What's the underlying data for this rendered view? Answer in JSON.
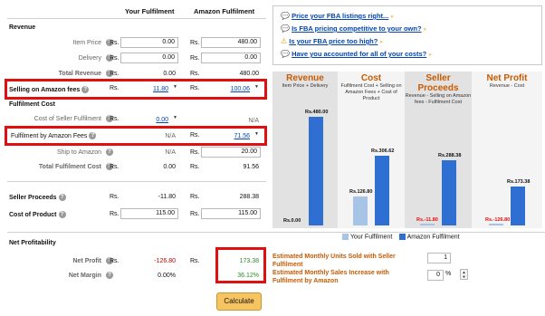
{
  "columns": {
    "your": "Your Fulfilment",
    "amazon": "Amazon Fulfilment"
  },
  "currency": "Rs.",
  "revenue": {
    "heading": "Revenue",
    "item_price": {
      "label": "Item Price",
      "your": "0.00",
      "amazon": "480.00"
    },
    "delivery": {
      "label": "Delivery",
      "your": "0.00",
      "amazon": "0.00"
    },
    "total": {
      "label": "Total Revenue",
      "your": "0.00",
      "amazon": "480.00"
    }
  },
  "selling_fees": {
    "label": "Selling on Amazon fees",
    "your": "11.80",
    "amazon": "100.06"
  },
  "fulfilment": {
    "heading": "Fulfilment Cost",
    "cost_seller": {
      "label": "Cost of Seller Fulfilment",
      "your": "0.00",
      "amazon": "N/A"
    },
    "by_amazon": {
      "label": "Fulfilment by Amazon Fees",
      "your": "N/A",
      "amazon": "71.56"
    },
    "ship": {
      "label": "Ship to Amazon",
      "your": "N/A",
      "amazon": "20.00"
    },
    "total": {
      "label": "Total Fulfilment Cost",
      "your": "0.00",
      "amazon": "91.56"
    }
  },
  "seller_proceeds": {
    "label": "Seller Proceeds",
    "your": "-11.80",
    "amazon": "288.38"
  },
  "cost_of_product": {
    "label": "Cost of Product",
    "your": "115.00",
    "amazon": "115.00"
  },
  "net": {
    "heading": "Net Profitability",
    "profit": {
      "label": "Net Profit",
      "your": "-126.80",
      "amazon": "173.38"
    },
    "margin": {
      "label": "Net Margin",
      "your": "0.00%",
      "amazon": "36.12%"
    }
  },
  "calculate_label": "Calculate",
  "links": [
    {
      "text": "Price your FBA listings right...",
      "icon": "speech-bubble-icon"
    },
    {
      "text": "Is FBA pricing competitive to your own?",
      "icon": "speech-bubble-icon"
    },
    {
      "text": "Is your FBA price too high?",
      "icon": "warning-icon"
    },
    {
      "text": "Have you accounted for all of your costs?",
      "icon": "speech-bubble-icon"
    }
  ],
  "chart": {
    "columns": [
      {
        "title": "Revenue",
        "sub": "Item Price + Delivery"
      },
      {
        "title": "Cost",
        "sub": "Fulfilment Cost + Selling on Amazon Fees + Cost of Product"
      },
      {
        "title": "Seller Proceeds",
        "sub": "Revenue - Selling on Amazon fees - Fulfilment Cost"
      },
      {
        "title": "Net Profit",
        "sub": "Revenue - Cost"
      }
    ],
    "legend": {
      "your": "Your Fulfilment",
      "amazon": "Amazon Fulfilment"
    },
    "bar_labels": {
      "rev_your": "Rs.0.00",
      "rev_amz": "Rs.480.00",
      "cost_your": "Rs.126.80",
      "cost_amz": "Rs.306.62",
      "sp_your": "Rs.-11.80",
      "sp_amz": "Rs.288.38",
      "np_your": "Rs.-126.80",
      "np_amz": "Rs.173.38"
    },
    "colors": {
      "your": "#a7c4e6",
      "amazon": "#2e6fd1",
      "negative": "#e01010",
      "header": "#c85a00",
      "band_dark": "#e2e2e2",
      "band_light": "#f4f4f4"
    }
  },
  "chart_data": {
    "type": "bar",
    "categories": [
      "Revenue",
      "Cost",
      "Seller Proceeds",
      "Net Profit"
    ],
    "series": [
      {
        "name": "Your Fulfilment",
        "values": [
          0.0,
          126.8,
          -11.8,
          -126.8
        ]
      },
      {
        "name": "Amazon Fulfilment",
        "values": [
          480.0,
          306.62,
          288.38,
          173.38
        ]
      }
    ]
  },
  "estimates": {
    "units": {
      "label": "Estimated Monthly Units Sold with Seller Fulfilment",
      "value": "1"
    },
    "increase": {
      "label": "Estimated Monthly Sales Increase with Fulfilment by Amazon",
      "value": "0",
      "unit": "%"
    }
  }
}
